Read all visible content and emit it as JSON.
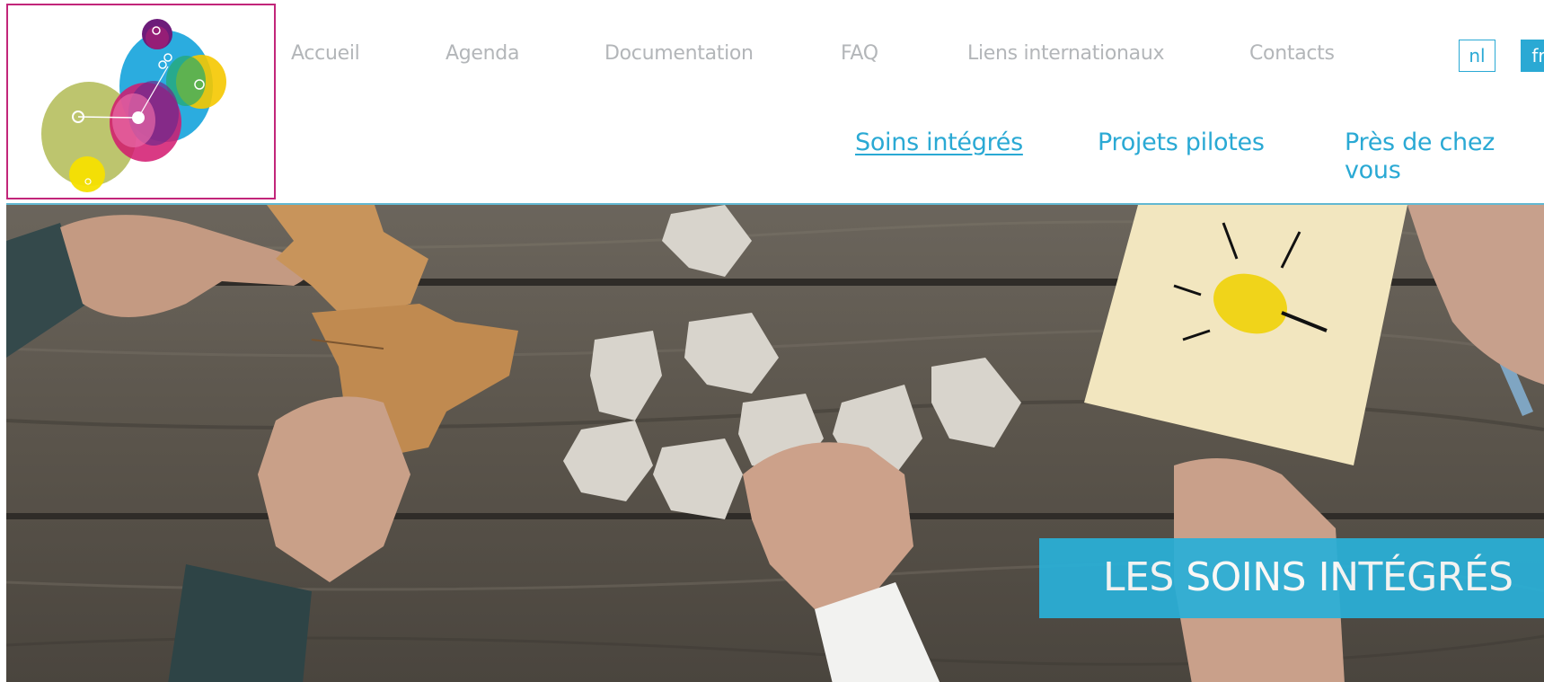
{
  "colors": {
    "accent": "#2aa9d4",
    "logo_border": "#c2267a",
    "top_nav_text": "#b3b6b9",
    "banner": "#2ab0d8"
  },
  "logo": {
    "icon": "colorful-bubbles-logo"
  },
  "top_nav": {
    "items": [
      {
        "label": "Accueil"
      },
      {
        "label": "Agenda"
      },
      {
        "label": "Documentation"
      },
      {
        "label": "FAQ"
      },
      {
        "label": "Liens internationaux"
      },
      {
        "label": "Contacts"
      }
    ]
  },
  "languages": {
    "nl": "nl",
    "fr": "fr",
    "selected": "fr"
  },
  "main_nav": {
    "items": [
      {
        "label": "Soins intégrés",
        "active": true
      },
      {
        "label": "Projets pilotes",
        "active": false
      },
      {
        "label": "Près de chez vous",
        "active": false
      }
    ]
  },
  "hero": {
    "image": "hands-assembling-puzzle-pieces-with-lightbulb-notepad",
    "banner_text": "LES SOINS INTÉGRÉS"
  }
}
